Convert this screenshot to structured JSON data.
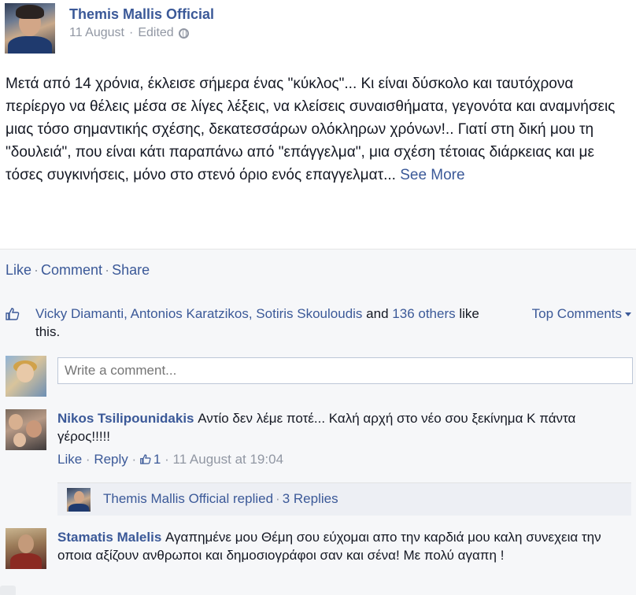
{
  "post": {
    "author": "Themis Mallis Official",
    "date": "11 August",
    "edited": "Edited",
    "privacy_icon": "globe-icon",
    "text": "Μετά από 14 χρόνια, έκλεισε σήμερα ένας \"κύκλος\"... Κι είναι δύσκολο και ταυτόχρονα περίεργο να θέλεις μέσα σε λίγες λέξεις, να κλείσεις συναισθήματα, γεγονότα και αναμνήσεις μιας τόσο σημαντικής σχέσης, δεκατεσσάρων ολόκληρων χρόνων!.. Γιατί στη δική μου τη \"δουλειά\", που είναι κάτι παραπάνω από \"επάγγελμα\", μια σχέση τέτοιας διάρκειας και με τόσες συγκινήσεις, μόνο στο στενό όριο ενός επαγγελματ...",
    "see_more": "See More"
  },
  "actions": {
    "like": "Like",
    "comment": "Comment",
    "share": "Share"
  },
  "likes": {
    "icon": "thumbs-up-icon",
    "names": "Vicky Diamanti, Antonios Karatzikos, Sotiris Skouloudis",
    "and_text": "and",
    "others": "136 others",
    "suffix": "like this.",
    "top_comments": "Top Comments"
  },
  "write_comment": {
    "placeholder": "Write a comment..."
  },
  "comments": [
    {
      "name": "Nikos Tsilipounidakis",
      "text": "Αντίο δεν λέμε ποτέ... Καλή αρχή στο νέο σου ξεκίνημα Κ πάντα γέρος!!!!!",
      "like": "Like",
      "reply": "Reply",
      "like_count": "1",
      "timestamp": "11 August at 19:04"
    },
    {
      "name": "Stamatis Malelis",
      "text": "Αγαπημένε μου Θέμη σου εύχομαι απο την καρδιά μου καλη συνεχεια την οποια αξίζουν ανθρωποι και δημοσιογράφοι σαν και σένα! Με πολύ αγαπη !"
    }
  ],
  "reply_summary": {
    "text": "Themis Mallis Official replied",
    "count": "3 Replies"
  },
  "colors": {
    "link": "#3b5998",
    "text": "#141823",
    "meta": "#9197a3",
    "feedback_bg": "#f6f7f9"
  }
}
